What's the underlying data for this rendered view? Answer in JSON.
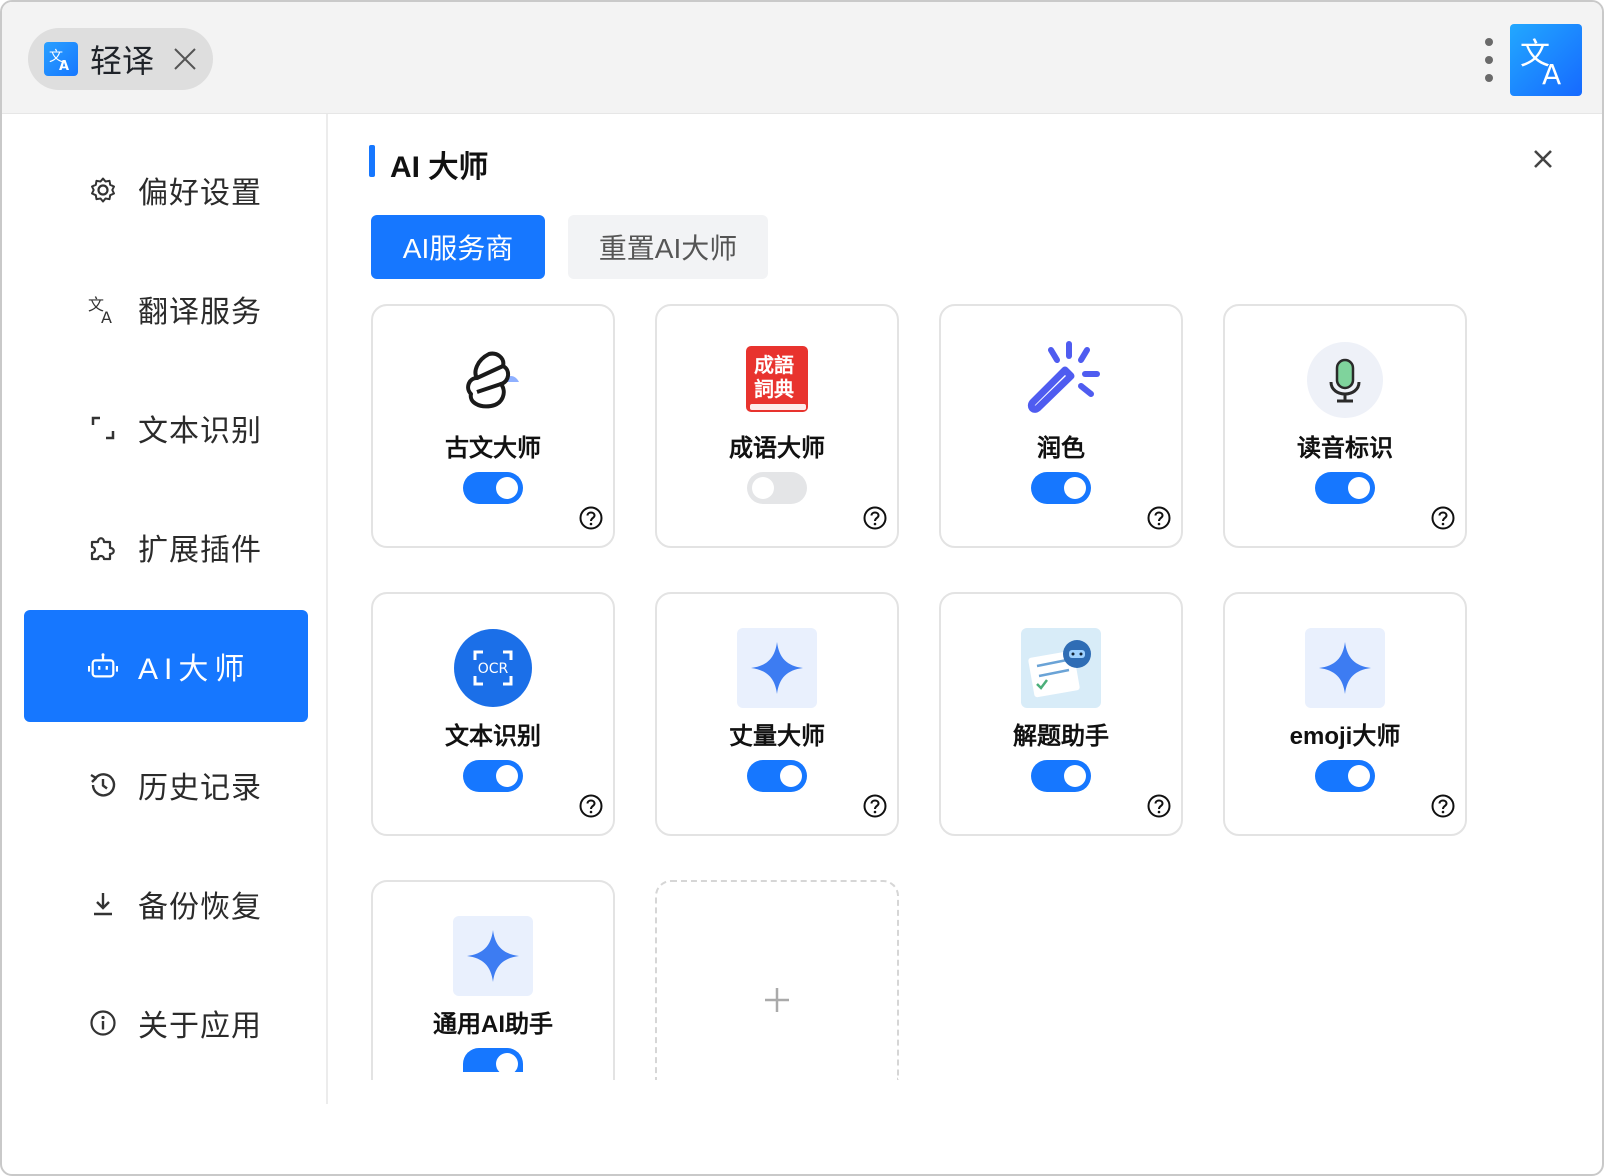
{
  "titlebar": {
    "app_title": "轻译"
  },
  "sidebar": {
    "items": [
      {
        "label": "偏好设置",
        "icon": "gear-icon"
      },
      {
        "label": "翻译服务",
        "icon": "translate-icon"
      },
      {
        "label": "文本识别",
        "icon": "scan-icon"
      },
      {
        "label": "扩展插件",
        "icon": "puzzle-icon"
      },
      {
        "label": "AI大师",
        "icon": "robot-icon",
        "active": true
      },
      {
        "label": "历史记录",
        "icon": "history-icon"
      },
      {
        "label": "备份恢复",
        "icon": "download-icon"
      },
      {
        "label": "关于应用",
        "icon": "info-icon"
      }
    ]
  },
  "main": {
    "title": "AI 大师",
    "tabs": {
      "primary": "AI服务商",
      "secondary": "重置AI大师"
    },
    "cards": [
      {
        "title": "古文大师",
        "enabled": true,
        "icon": "ancient-scholar-icon"
      },
      {
        "title": "成语大师",
        "enabled": false,
        "icon": "idiom-dictionary-icon"
      },
      {
        "title": "润色",
        "enabled": true,
        "icon": "magic-wand-icon"
      },
      {
        "title": "读音标识",
        "enabled": true,
        "icon": "microphone-icon"
      },
      {
        "title": "文本识别",
        "enabled": true,
        "icon": "ocr-icon"
      },
      {
        "title": "丈量大师",
        "enabled": true,
        "icon": "sparkle-icon"
      },
      {
        "title": "解题助手",
        "enabled": true,
        "icon": "robot-solver-icon"
      },
      {
        "title": "emoji大师",
        "enabled": true,
        "icon": "sparkle-icon"
      },
      {
        "title": "通用AI助手",
        "enabled": true,
        "icon": "sparkle-icon"
      }
    ],
    "add_card_symbol": "+"
  },
  "colors": {
    "accent": "#1677ff",
    "toggle_off": "#e4e5e7",
    "idiom_red": "#e8332e",
    "wand_purple": "#4f5cf0"
  }
}
